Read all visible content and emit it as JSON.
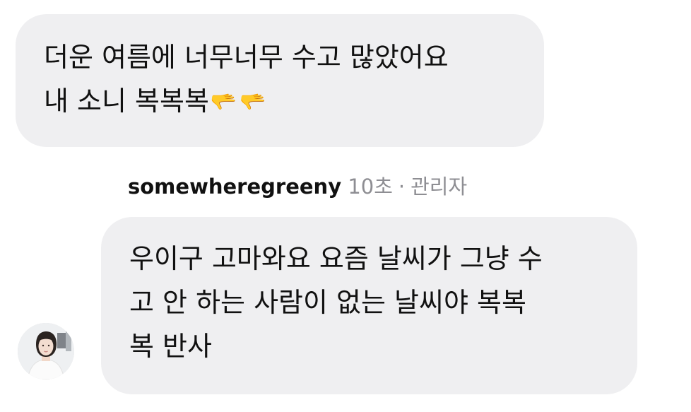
{
  "comment": {
    "lines": [
      "더운 여름에 너무너무 수고 많았어요",
      "내 소니 복복복"
    ],
    "emoji": "🫳🫳"
  },
  "reply": {
    "username": "somewheregreeny",
    "time": "10초",
    "separator": "·",
    "role": "관리자",
    "lines": [
      "우이구 고마와요 요즘 날씨가 그냥 수",
      "고 안 하는 사람이 없는 날씨야 복복",
      "복 반사"
    ]
  },
  "avatar": {
    "icon": "profile-photo-avatar"
  }
}
